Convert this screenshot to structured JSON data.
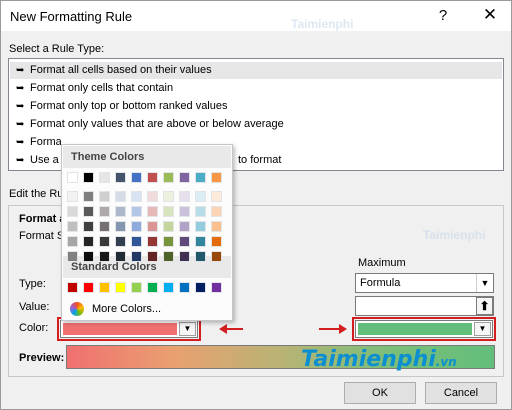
{
  "window": {
    "title": "New Formatting Rule",
    "help_label": "?",
    "close_label": "✕"
  },
  "rule_type": {
    "label": "Select a Rule Type:",
    "items": [
      {
        "text": "Format all cells based on their values",
        "selected": true
      },
      {
        "text": "Format only cells that contain",
        "selected": false
      },
      {
        "text": "Format only top or bottom ranked values",
        "selected": false
      },
      {
        "text": "Format only values that are above or below average",
        "selected": false
      },
      {
        "text": "Format only unique or duplicate values",
        "selected": false
      },
      {
        "text": "Use a formula to determine which cells to format",
        "selected": false
      }
    ],
    "visible_fragments": {
      "item5": "Forma",
      "item6_start": "Use a",
      "item6_end": "to format"
    }
  },
  "edit": {
    "label_fragment": "Edit the Ru",
    "format_fragment": "Format a",
    "format_style_fragment": "Format S",
    "type_label": "Type:",
    "value_label": "Value:",
    "color_label": "Color:",
    "preview_label": "Preview:",
    "maximum_heading": "Maximum",
    "maximum_type_value": "Formula",
    "maximum_value_value": "",
    "minimum_color": "#f07070",
    "maximum_color": "#63be7b"
  },
  "palette": {
    "theme_heading": "Theme Colors",
    "standard_heading": "Standard Colors",
    "more_colors_label": "More Colors...",
    "theme_columns": [
      [
        "#ffffff",
        "#f2f2f2",
        "#d9d9d9",
        "#bfbfbf",
        "#a6a6a6",
        "#808080"
      ],
      [
        "#000000",
        "#7f7f7f",
        "#595959",
        "#404040",
        "#262626",
        "#0d0d0d"
      ],
      [
        "#e7e6e6",
        "#d0cece",
        "#aeaaaa",
        "#757171",
        "#3a3838",
        "#171616"
      ],
      [
        "#44546a",
        "#d6dce5",
        "#adb9ca",
        "#8497b0",
        "#333f50",
        "#222a35"
      ],
      [
        "#4472c4",
        "#dae3f3",
        "#b4c7e7",
        "#8faadc",
        "#2f5597",
        "#1f3864"
      ],
      [
        "#c0504d",
        "#f2dcdb",
        "#e6b9b8",
        "#d99694",
        "#953735",
        "#632523"
      ],
      [
        "#9bbb59",
        "#ebf1de",
        "#d7e4bd",
        "#c3d69b",
        "#77933c",
        "#4f6228"
      ],
      [
        "#8064a2",
        "#e6e0ec",
        "#ccc1da",
        "#b3a2c7",
        "#604a7b",
        "#403152"
      ],
      [
        "#4bacc6",
        "#dbeef4",
        "#b7dee8",
        "#93cddd",
        "#31859c",
        "#215968"
      ],
      [
        "#f79646",
        "#fdeada",
        "#fbd5b5",
        "#fac090",
        "#e46c0a",
        "#984807"
      ]
    ],
    "standard": [
      "#c00000",
      "#ff0000",
      "#ffc000",
      "#ffff00",
      "#92d050",
      "#00b050",
      "#00b0f0",
      "#0070c0",
      "#002060",
      "#7030a0"
    ]
  },
  "buttons": {
    "ok_label": "OK",
    "cancel_label": "Cancel"
  },
  "watermark": {
    "text": "Taimienphi",
    "suffix": ".vn"
  }
}
